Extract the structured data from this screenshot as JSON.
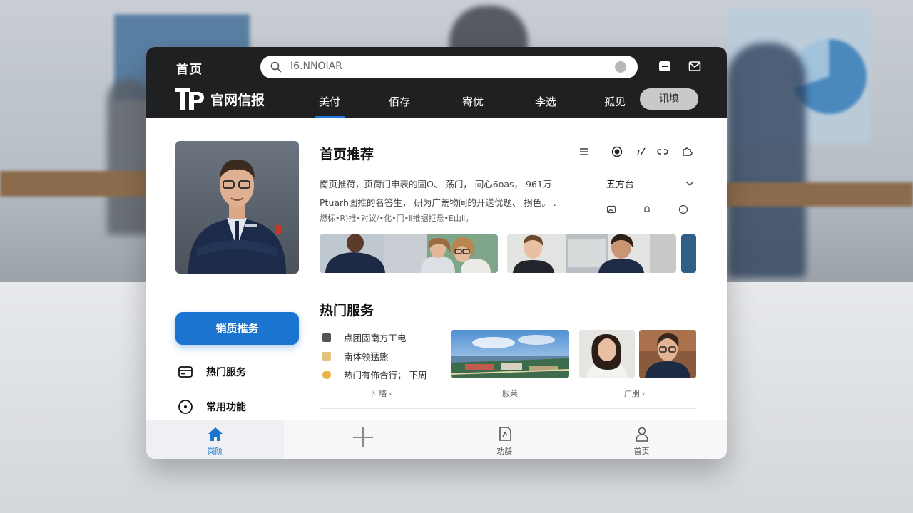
{
  "header": {
    "home_title": "首页",
    "search_value": "I6.NNOIAR",
    "brand_name": "官网信报"
  },
  "nav": {
    "tabs": [
      {
        "label": "美付",
        "active": true
      },
      {
        "label": "佰存",
        "active": false
      },
      {
        "label": "寄优",
        "active": false
      },
      {
        "label": "李选",
        "active": false
      },
      {
        "label": "孤见",
        "active": false
      }
    ],
    "pill_label": "讯填"
  },
  "sidebar": {
    "cta_label": "销质推务",
    "links": [
      {
        "label": "热门服务",
        "icon": "card-icon"
      },
      {
        "label": "常用功能",
        "icon": "play-circle-icon"
      }
    ]
  },
  "recommend": {
    "title": "首页推荐",
    "desc_lines": [
      "南页推荷，页荷门申表的固O、 荡门， 同心6oas， 961万",
      "Ptuarh固推的名答生， 研为广荒物间的开送优题、 拐色。 .",
      "燃标•R)推•对议/•化•门•Ⅱ推据拒悬•E山Ⅱ。"
    ],
    "select_value": "五方台"
  },
  "services": {
    "title": "热门服务",
    "items": [
      {
        "label": "点团固南方工电"
      },
      {
        "label": "南体领猛熊"
      },
      {
        "label": "热门有佈合行； 下周"
      }
    ],
    "captions": [
      "阝略 ‹",
      "服莱",
      "广朋 ‹"
    ]
  },
  "bottom_nav": [
    {
      "label": "岗阶",
      "icon": "home-icon",
      "active": true
    },
    {
      "label": "",
      "icon": "plus-icon",
      "active": false
    },
    {
      "label": "劝龄",
      "icon": "document-icon",
      "active": false
    },
    {
      "label": "首页",
      "icon": "user-icon",
      "active": false
    }
  ],
  "colors": {
    "accent": "#1b74cf",
    "topbar": "#1f2022"
  }
}
